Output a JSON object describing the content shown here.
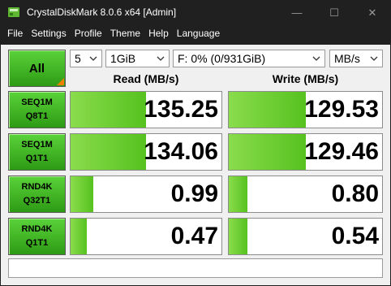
{
  "window": {
    "title": "CrystalDiskMark 8.0.6 x64 [Admin]",
    "minimize_glyph": "—",
    "maximize_glyph": "☐",
    "close_glyph": "✕"
  },
  "menu": [
    "File",
    "Settings",
    "Profile",
    "Theme",
    "Help",
    "Language"
  ],
  "controls": {
    "all_label": "All",
    "test_count": "5",
    "test_size": "1GiB",
    "drive": "F: 0% (0/931GiB)",
    "unit": "MB/s"
  },
  "headers": {
    "read": "Read (MB/s)",
    "write": "Write (MB/s)"
  },
  "tests": [
    {
      "line1": "SEQ1M",
      "line2": "Q8T1",
      "read": "135.25",
      "write": "129.53",
      "read_fill": 0.5,
      "write_fill": 0.5
    },
    {
      "line1": "SEQ1M",
      "line2": "Q1T1",
      "read": "134.06",
      "write": "129.46",
      "read_fill": 0.5,
      "write_fill": 0.5
    },
    {
      "line1": "RND4K",
      "line2": "Q32T1",
      "read": "0.99",
      "write": "0.80",
      "read_fill": 0.15,
      "write_fill": 0.12
    },
    {
      "line1": "RND4K",
      "line2": "Q1T1",
      "read": "0.47",
      "write": "0.54",
      "read_fill": 0.11,
      "write_fill": 0.12
    }
  ],
  "comment": "",
  "colors": {
    "accent_green": "#3cb41e",
    "corner_orange": "#f08000"
  }
}
